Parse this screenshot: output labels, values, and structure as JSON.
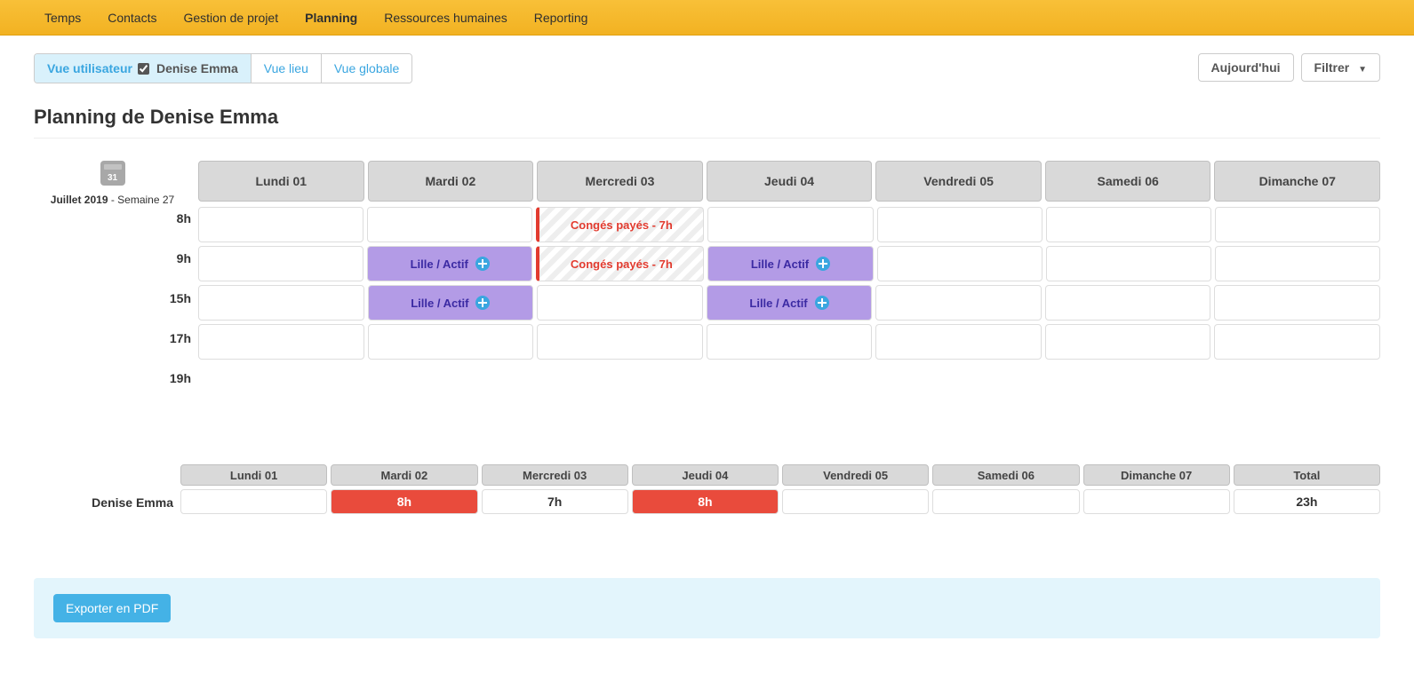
{
  "nav": {
    "items": [
      {
        "label": "Temps",
        "active": false
      },
      {
        "label": "Contacts",
        "active": false
      },
      {
        "label": "Gestion de projet",
        "active": false
      },
      {
        "label": "Planning",
        "active": true
      },
      {
        "label": "Ressources humaines",
        "active": false
      },
      {
        "label": "Reporting",
        "active": false
      }
    ]
  },
  "toolbar": {
    "tabs": {
      "user_view": "Vue utilisateur",
      "user_name": "Denise Emma",
      "place_view": "Vue lieu",
      "global_view": "Vue globale"
    },
    "today_btn": "Aujourd'hui",
    "filter_btn": "Filtrer"
  },
  "page": {
    "title": "Planning de Denise Emma",
    "period_month": "Juillet 2019",
    "period_week": " - Semaine 27"
  },
  "days": [
    "Lundi 01",
    "Mardi 02",
    "Mercredi 03",
    "Jeudi 04",
    "Vendredi 05",
    "Samedi 06",
    "Dimanche 07"
  ],
  "hours": [
    "8h",
    "9h",
    "15h",
    "17h",
    "19h"
  ],
  "grid": [
    [
      {
        "t": "",
        "k": ""
      },
      {
        "t": "",
        "k": ""
      },
      {
        "t": "Congés payés - 7h",
        "k": "hatched"
      },
      {
        "t": "",
        "k": ""
      },
      {
        "t": "",
        "k": ""
      },
      {
        "t": "",
        "k": ""
      },
      {
        "t": "",
        "k": ""
      }
    ],
    [
      {
        "t": "",
        "k": ""
      },
      {
        "t": "Lille / Actif",
        "k": "purple"
      },
      {
        "t": "Congés payés - 7h",
        "k": "hatched"
      },
      {
        "t": "Lille / Actif",
        "k": "purple"
      },
      {
        "t": "",
        "k": ""
      },
      {
        "t": "",
        "k": ""
      },
      {
        "t": "",
        "k": ""
      }
    ],
    [
      {
        "t": "",
        "k": ""
      },
      {
        "t": "Lille / Actif",
        "k": "purple"
      },
      {
        "t": "",
        "k": ""
      },
      {
        "t": "Lille / Actif",
        "k": "purple"
      },
      {
        "t": "",
        "k": ""
      },
      {
        "t": "",
        "k": ""
      },
      {
        "t": "",
        "k": ""
      }
    ],
    [
      {
        "t": "",
        "k": ""
      },
      {
        "t": "",
        "k": ""
      },
      {
        "t": "",
        "k": ""
      },
      {
        "t": "",
        "k": ""
      },
      {
        "t": "",
        "k": ""
      },
      {
        "t": "",
        "k": ""
      },
      {
        "t": "",
        "k": ""
      }
    ]
  ],
  "summary": {
    "row_label": "Denise Emma",
    "headers": [
      "Lundi 01",
      "Mardi 02",
      "Mercredi 03",
      "Jeudi 04",
      "Vendredi 05",
      "Samedi 06",
      "Dimanche 07",
      "Total"
    ],
    "cells": [
      {
        "t": "",
        "k": ""
      },
      {
        "t": "8h",
        "k": "red"
      },
      {
        "t": "7h",
        "k": ""
      },
      {
        "t": "8h",
        "k": "red"
      },
      {
        "t": "",
        "k": ""
      },
      {
        "t": "",
        "k": ""
      },
      {
        "t": "",
        "k": ""
      },
      {
        "t": "23h",
        "k": ""
      }
    ]
  },
  "footer": {
    "export_btn": "Exporter en PDF"
  }
}
